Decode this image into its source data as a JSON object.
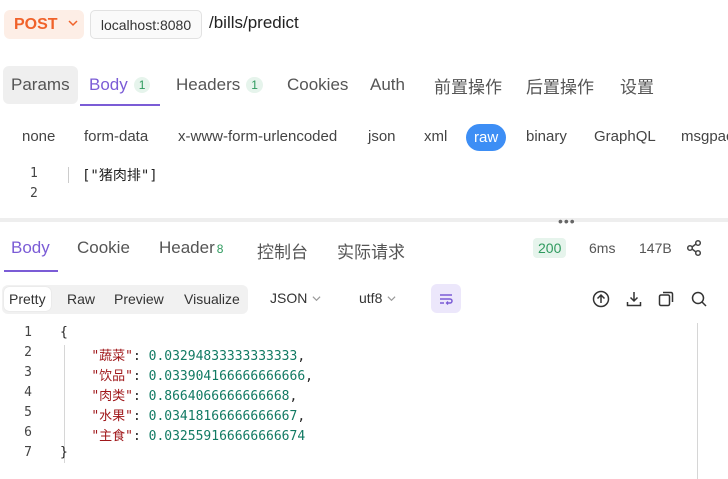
{
  "request": {
    "method": "POST",
    "host": "localhost:8080",
    "path": "/bills/predict"
  },
  "request_tabs": [
    {
      "label": "Params",
      "badge": ""
    },
    {
      "label": "Body",
      "badge": "1"
    },
    {
      "label": "Headers",
      "badge": "1"
    },
    {
      "label": "Cookies",
      "badge": ""
    },
    {
      "label": "Auth",
      "badge": ""
    },
    {
      "label": "前置操作",
      "badge": ""
    },
    {
      "label": "后置操作",
      "badge": ""
    },
    {
      "label": "设置",
      "badge": ""
    }
  ],
  "body_types": [
    "none",
    "form-data",
    "x-www-form-urlencoded",
    "json",
    "xml",
    "raw",
    "binary",
    "GraphQL",
    "msgpack"
  ],
  "request_editor": {
    "line_numbers": [
      "1",
      "2"
    ],
    "content": "[\"猪肉排\"]"
  },
  "response_tabs": [
    {
      "label": "Body",
      "badge": ""
    },
    {
      "label": "Cookie",
      "badge": ""
    },
    {
      "label": "Header",
      "badge": "8"
    },
    {
      "label": "控制台",
      "badge": ""
    },
    {
      "label": "实际请求",
      "badge": ""
    }
  ],
  "response_meta": {
    "status": "200",
    "time": "6ms",
    "size": "147B"
  },
  "response_toolbar": {
    "views": [
      "Pretty",
      "Raw",
      "Preview",
      "Visualize"
    ],
    "format": "JSON",
    "encoding": "utf8"
  },
  "response_body": {
    "open_brace": "{",
    "close_brace": "}",
    "entries": [
      {
        "key": "\"蔬菜\"",
        "value": "0.03294833333333333"
      },
      {
        "key": "\"饮品\"",
        "value": "0.033904166666666666"
      },
      {
        "key": "\"肉类\"",
        "value": "0.8664066666666668"
      },
      {
        "key": "\"水果\"",
        "value": "0.03418166666666667"
      },
      {
        "key": "\"主食\"",
        "value": "0.032559166666666674"
      }
    ],
    "line_numbers": [
      "1",
      "2",
      "3",
      "4",
      "5",
      "6",
      "7"
    ]
  },
  "colors": {
    "accent": "#7b5cd6",
    "method": "#f0622a",
    "raw_selected": "#3d8ef5",
    "status_ok": "#2e9a5e"
  },
  "icons": [
    "chevron-down-icon",
    "share-icon",
    "text-wrap-icon",
    "upload-icon",
    "download-icon",
    "copy-icon",
    "search-icon"
  ]
}
